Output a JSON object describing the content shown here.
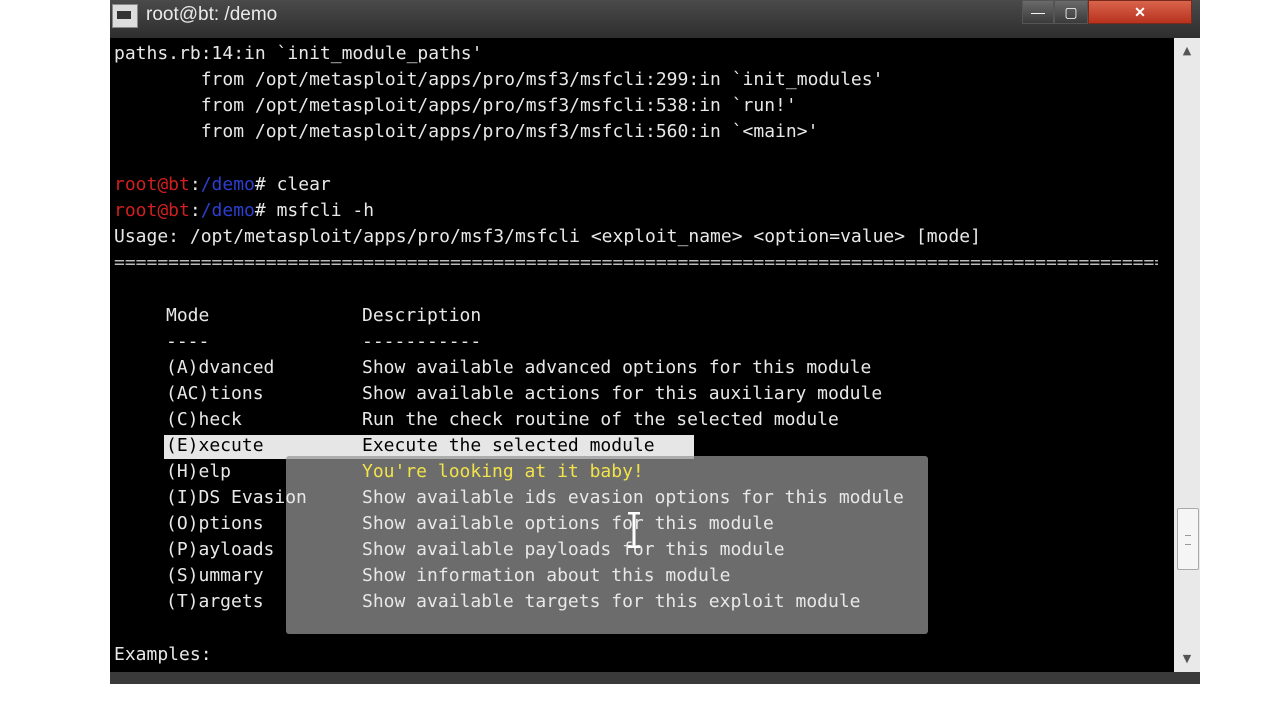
{
  "window": {
    "title": "root@bt: /demo",
    "icons": {
      "app": "terminal-icon",
      "minimize": "minimize-icon",
      "maximize": "maximize-icon",
      "close": "close-icon"
    },
    "buttons": {
      "minimize": "—",
      "maximize": "▢",
      "close": "✕"
    }
  },
  "terminal": {
    "trace": [
      "paths.rb:14:in `init_module_paths'",
      "        from /opt/metasploit/apps/pro/msf3/msfcli:299:in `init_modules'",
      "        from /opt/metasploit/apps/pro/msf3/msfcli:538:in `run!'",
      "        from /opt/metasploit/apps/pro/msf3/msfcli:560:in `<main>'"
    ],
    "prompt": {
      "user": "root@bt",
      "colon": ":",
      "path": "/demo",
      "hash": "# "
    },
    "commands": [
      "clear",
      "msfcli -h"
    ],
    "usage": "Usage: /opt/metasploit/apps/pro/msf3/msfcli <exploit_name> <option=value> [mode]",
    "separator": "==============================================================================================================",
    "table": {
      "header_mode": "Mode",
      "header_desc": "Description",
      "rule_mode": "----",
      "rule_desc": "-----------",
      "rows": [
        {
          "mode": "(A)dvanced",
          "desc": "Show available advanced options for this module"
        },
        {
          "mode": "(AC)tions",
          "desc": "Show available actions for this auxiliary module"
        },
        {
          "mode": "(C)heck",
          "desc": "Run the check routine of the selected module"
        },
        {
          "mode": "(E)xecute",
          "desc": "Execute the selected module"
        },
        {
          "mode": "(H)elp",
          "desc": "You're looking at it baby!"
        },
        {
          "mode": "(I)DS Evasion",
          "desc": "Show available ids evasion options for this module"
        },
        {
          "mode": "(O)ptions",
          "desc": "Show available options for this module"
        },
        {
          "mode": "(P)ayloads",
          "desc": "Show available payloads for this module"
        },
        {
          "mode": "(S)ummary",
          "desc": "Show information about this module"
        },
        {
          "mode": "(T)argets",
          "desc": "Show available targets for this exploit module"
        }
      ]
    },
    "examples_label": "Examples:"
  },
  "scrollbar": {
    "up": "▲",
    "down": "▼"
  },
  "colors": {
    "prompt_user": "#d21f1f",
    "prompt_path": "#2c3fd0",
    "highlight": "#f2e34a",
    "text": "#e8e8e8"
  }
}
